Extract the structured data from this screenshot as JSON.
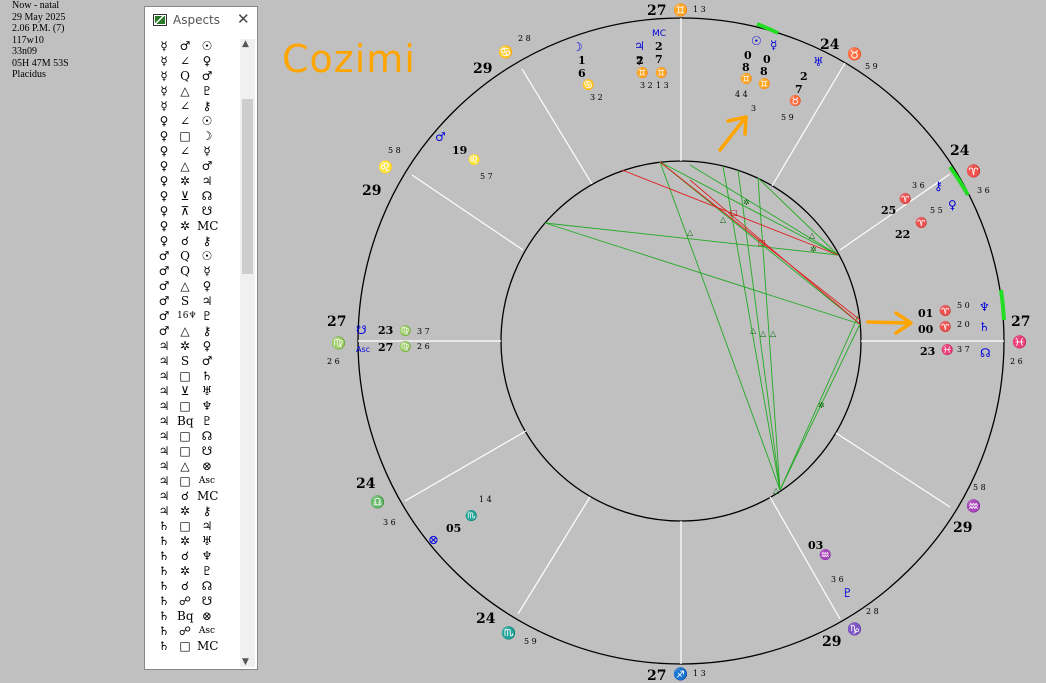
{
  "info": {
    "line1": "Now - natal",
    "line2": "29 May 2025",
    "line3": "2.06 P.M. (7)",
    "line4": "117w10",
    "line5": "33n09",
    "line6": "05H  47M  53S",
    "line7": "Placidus"
  },
  "aspects_window": {
    "title": "Aspects",
    "rows": [
      [
        "☿",
        "♂",
        "☉"
      ],
      [
        "☿",
        "∠",
        "♀"
      ],
      [
        "☿",
        "Q",
        "♂"
      ],
      [
        "☿",
        "△",
        "♇"
      ],
      [
        "☿",
        "∠",
        "⚷"
      ],
      [
        "♀",
        "∠",
        "☉"
      ],
      [
        "♀",
        "□",
        "☽"
      ],
      [
        "♀",
        "∠",
        "☿"
      ],
      [
        "♀",
        "△",
        "♂"
      ],
      [
        "♀",
        "✲",
        "♃"
      ],
      [
        "♀",
        "⊻",
        "☊"
      ],
      [
        "♀",
        "⊼",
        "☋"
      ],
      [
        "♀",
        "✲",
        "MC"
      ],
      [
        "♀",
        "☌",
        "⚷"
      ],
      [
        "♂",
        "Q",
        "☉"
      ],
      [
        "♂",
        "Q",
        "☿"
      ],
      [
        "♂",
        "△",
        "♀"
      ],
      [
        "♂",
        "S",
        "♃"
      ],
      [
        "♂",
        "16♆",
        "♇"
      ],
      [
        "♂",
        "△",
        "⚷"
      ],
      [
        "♃",
        "✲",
        "♀"
      ],
      [
        "♃",
        "S",
        "♂"
      ],
      [
        "♃",
        "□",
        "♄"
      ],
      [
        "♃",
        "⊻",
        "♅"
      ],
      [
        "♃",
        "□",
        "♆"
      ],
      [
        "♃",
        "Bq",
        "♇"
      ],
      [
        "♃",
        "□",
        "☊"
      ],
      [
        "♃",
        "□",
        "☋"
      ],
      [
        "♃",
        "△",
        "⊗"
      ],
      [
        "♃",
        "□",
        "Asc"
      ],
      [
        "♃",
        "☌",
        "MC"
      ],
      [
        "♃",
        "✲",
        "⚷"
      ],
      [
        "♄",
        "□",
        "♃"
      ],
      [
        "♄",
        "✲",
        "♅"
      ],
      [
        "♄",
        "☌",
        "♆"
      ],
      [
        "♄",
        "✲",
        "♇"
      ],
      [
        "♄",
        "☌",
        "☊"
      ],
      [
        "♄",
        "☍",
        "☋"
      ],
      [
        "♄",
        "Bq",
        "⊗"
      ],
      [
        "♄",
        "☍",
        "Asc"
      ],
      [
        "♄",
        "□",
        "MC"
      ]
    ]
  },
  "annotation_text": "Cozimi",
  "cusps": {
    "mc_deg": "27",
    "mc_sign": "♊",
    "mc_min": "1 3",
    "h11_deg": "24",
    "h11_sign": "♉",
    "h11_min": "5 9",
    "h12_deg": "24",
    "h12_sign": "♈",
    "h12_min": "3 6",
    "asc_deg": "27",
    "asc_sign": "♓",
    "asc_min": "2 6",
    "h2_deg": "29",
    "h2_sign": "♒",
    "h2_min": "5 8",
    "h3_deg": "29",
    "h3_sign": "♑",
    "h3_min": "2 8",
    "ic_deg": "27",
    "ic_sign": "♐",
    "ic_min": "1 3",
    "h5_deg": "24",
    "h5_sign": "♏",
    "h5_min": "5 9",
    "h6_deg": "24",
    "h6_sign": "♎",
    "h6_min": "3 6",
    "dsc_deg": "27",
    "dsc_sign": "♍",
    "dsc_min": "2 6",
    "h8_deg": "29",
    "h8_sign": "♌",
    "h8_min": "5 8",
    "h9_deg": "29",
    "h9_sign": "♋",
    "h9_min": "2 8"
  },
  "planets": {
    "moon": {
      "glyph": "☽",
      "deg1": "1",
      "deg2": "6",
      "sign": "♋",
      "min": "3 2"
    },
    "jupiter": {
      "glyph": "♃",
      "deg1": "2",
      "deg2": "7",
      "sign": "♊",
      "min": "3 2"
    },
    "mc_pt": {
      "glyph": "MC",
      "deg1": "2",
      "deg2": "7",
      "sign": "♊",
      "min": "1 3"
    },
    "sun": {
      "glyph": "☉",
      "deg1": "0",
      "deg2": "8",
      "sign": "♊",
      "min": "4 4"
    },
    "mercury": {
      "glyph": "☿",
      "deg1": "0",
      "deg2": "8",
      "sign": "♊",
      "min": "3"
    },
    "uranus": {
      "glyph": "♅",
      "deg1": "2",
      "deg2": "7",
      "sign": "♉",
      "min": "5 9"
    },
    "mars": {
      "glyph": "♂",
      "deg": "19",
      "sign": "♌",
      "min": "5 7"
    },
    "chiron": {
      "glyph": "⚷",
      "deg": "25",
      "sign": "♈",
      "min": "3 6"
    },
    "venus": {
      "glyph": "♀",
      "deg": "22",
      "sign": "♈",
      "min": "5 5"
    },
    "neptune": {
      "glyph": "♆",
      "deg": "01",
      "sign": "♈",
      "min": "5 0"
    },
    "saturn": {
      "glyph": "♄",
      "deg": "00",
      "sign": "♈",
      "min": "2 0"
    },
    "node": {
      "glyph": "☊",
      "deg": "23",
      "sign": "♓",
      "min": "3 7"
    },
    "south_node": {
      "glyph": "☋",
      "deg": "23",
      "sign": "♍",
      "min": "3 7"
    },
    "asc_pt": {
      "glyph": "Asc",
      "deg": "27",
      "sign": "♍",
      "min": "2 6"
    },
    "fortune": {
      "glyph": "⊗",
      "deg": "05",
      "sign": "♏",
      "min": "1 4"
    },
    "pluto": {
      "glyph": "♇",
      "deg": "03",
      "sign": "♒",
      "min": "3 6"
    }
  }
}
